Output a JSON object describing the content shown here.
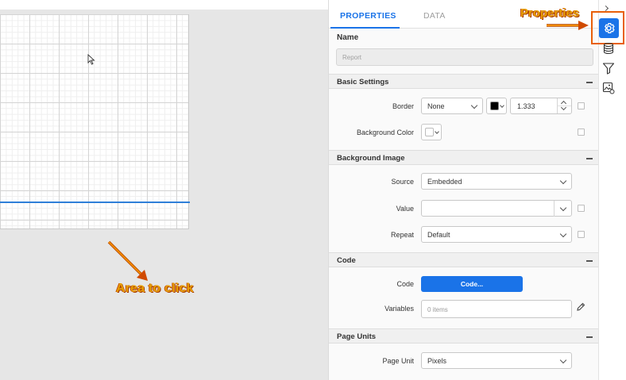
{
  "annotations": {
    "area_label": "Area to click",
    "properties_label": "Properties",
    "annotation_color": "#e8a000"
  },
  "tabs": {
    "properties": "PROPERTIES",
    "data": "DATA",
    "active": "PROPERTIES"
  },
  "name": {
    "label": "Name",
    "placeholder": "Report"
  },
  "basic_settings": {
    "title": "Basic Settings",
    "border_label": "Border",
    "border_style": "None",
    "border_color": "#000000",
    "border_width": "1.333",
    "background_color_label": "Background Color",
    "background_color": "#ffffff"
  },
  "background_image": {
    "title": "Background Image",
    "source_label": "Source",
    "source_value": "Embedded",
    "value_label": "Value",
    "value_value": "",
    "repeat_label": "Repeat",
    "repeat_value": "Default"
  },
  "code": {
    "title": "Code",
    "code_label": "Code",
    "code_button": "Code...",
    "variables_label": "Variables",
    "variables_placeholder": "0 items"
  },
  "page_units": {
    "title": "Page Units",
    "page_unit_label": "Page Unit",
    "page_unit_value": "Pixels"
  },
  "toolbar": {
    "icons": [
      "chevron-right-icon",
      "gear-icon",
      "database-icon",
      "filter-icon",
      "image-settings-icon"
    ],
    "accent": "#1a73e8"
  }
}
